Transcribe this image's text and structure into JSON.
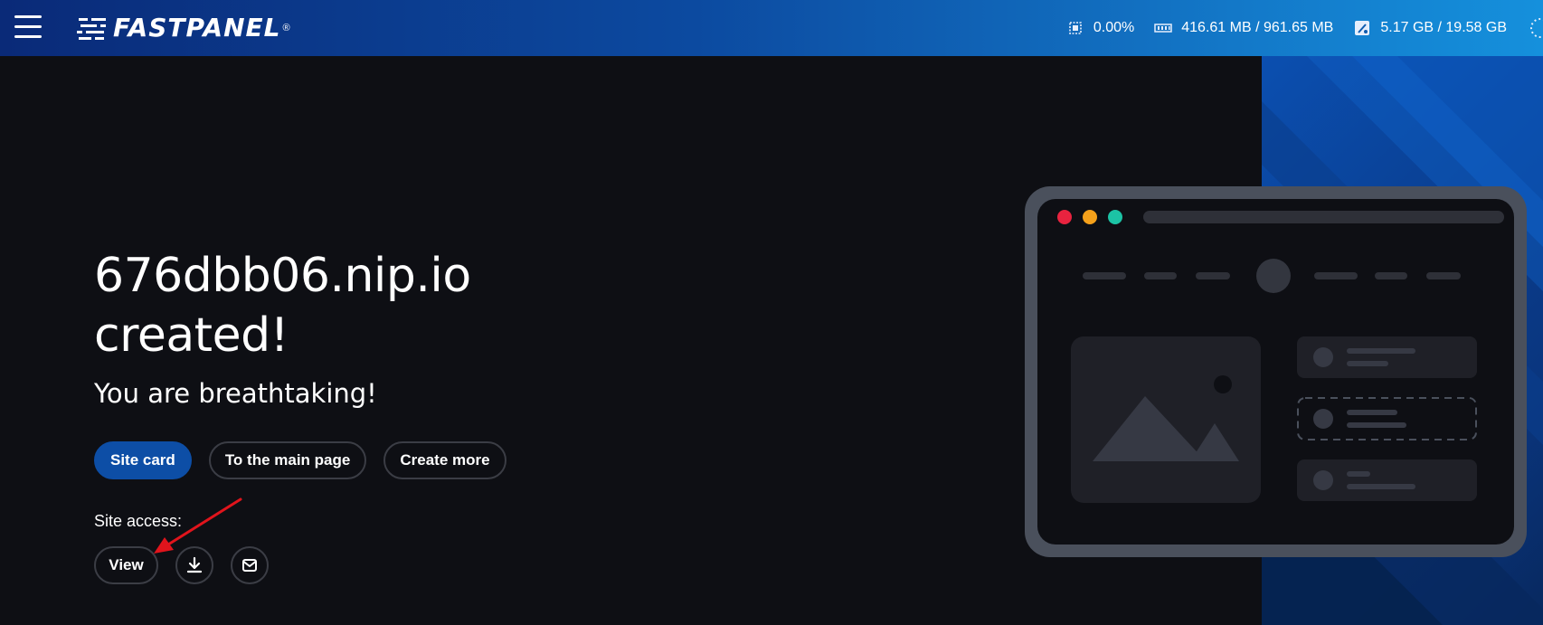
{
  "header": {
    "logo_text": "FASTPANEL",
    "logo_reg": "®",
    "stats": {
      "cpu": "0.00%",
      "ram": "416.61 MB / 961.65 MB",
      "disk": "5.17 GB / 19.58 GB"
    }
  },
  "main": {
    "title_line1": "676dbb06.nip.io",
    "title_line2": "created!",
    "subtitle": "You are breathtaking!",
    "buttons": {
      "site_card": "Site card",
      "main_page": "To the main page",
      "create_more": "Create more"
    },
    "access_label": "Site access:",
    "view_label": "View"
  },
  "icons": [
    "menu-icon",
    "cpu-icon",
    "ram-icon",
    "disk-icon",
    "download-icon",
    "mail-icon"
  ],
  "colors": {
    "background": "#0e0f14",
    "primary_button": "#0d4ea6",
    "header_start": "#0a2a78",
    "header_end": "#1590dc",
    "arrow": "#e0141c"
  }
}
